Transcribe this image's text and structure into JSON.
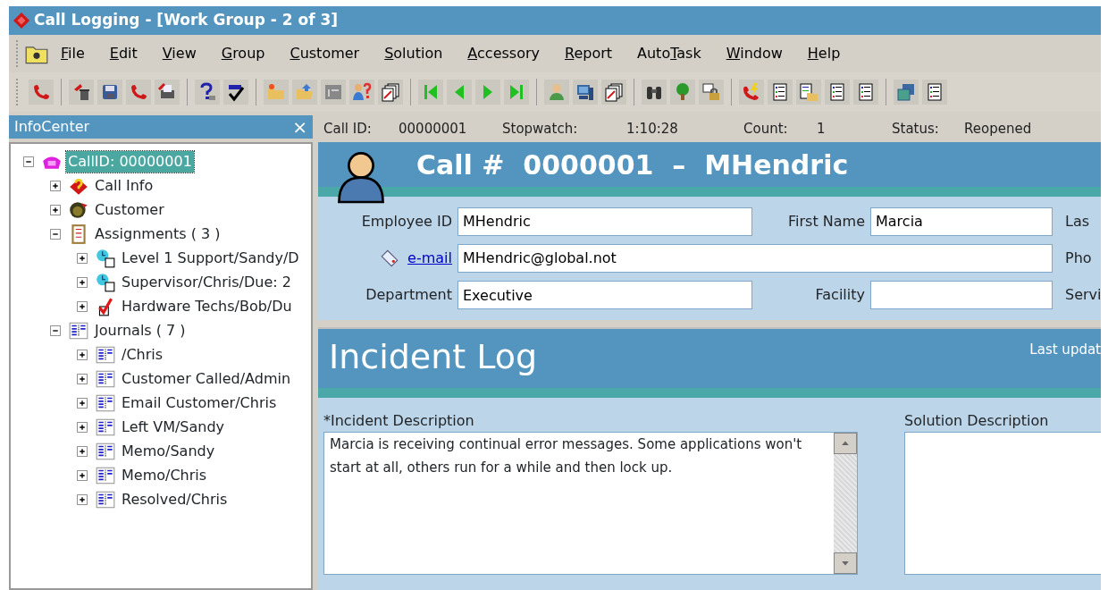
{
  "window": {
    "title": "Call Logging - [Work Group - 2 of 3]"
  },
  "menu": [
    {
      "key": "F",
      "post": "ile"
    },
    {
      "key": "E",
      "post": "dit"
    },
    {
      "key": "V",
      "post": "iew"
    },
    {
      "key": "G",
      "post": "roup"
    },
    {
      "key": "C",
      "post": "ustomer"
    },
    {
      "key": "S",
      "post": "olution"
    },
    {
      "key": "A",
      "post": "ccessory"
    },
    {
      "key": "R",
      "post": "eport"
    },
    {
      "pre": "Auto",
      "key": "T",
      "post": "ask"
    },
    {
      "key": "W",
      "post": "indow"
    },
    {
      "key": "H",
      "post": "elp"
    }
  ],
  "infocenter": {
    "title": "InfoCenter",
    "close": "×",
    "tree": [
      {
        "label": "CallID: 00000001",
        "kind": "root",
        "expanded": true,
        "selected": true,
        "children": [
          {
            "label": "Call Info",
            "kind": "info",
            "expanded": false,
            "selected": false
          },
          {
            "label": "Customer",
            "kind": "customer",
            "expanded": false,
            "selected": false
          },
          {
            "label": "Assignments ( 3 )",
            "kind": "assignments",
            "expanded": true,
            "selected": false,
            "children": [
              {
                "label": "Level 1 Support/Sandy/D",
                "kind": "pending",
                "expanded": false,
                "selected": false
              },
              {
                "label": "Supervisor/Chris/Due: 2",
                "kind": "pending",
                "expanded": false,
                "selected": false
              },
              {
                "label": "Hardware Techs/Bob/Du",
                "kind": "done",
                "expanded": false,
                "selected": false
              }
            ]
          },
          {
            "label": "Journals ( 7 )",
            "kind": "journal",
            "expanded": true,
            "selected": false,
            "children": [
              {
                "label": "/Chris",
                "kind": "journal",
                "expanded": false,
                "selected": false
              },
              {
                "label": "Customer Called/Admin",
                "kind": "journal",
                "expanded": false,
                "selected": false
              },
              {
                "label": "Email Customer/Chris",
                "kind": "journal",
                "expanded": false,
                "selected": false
              },
              {
                "label": "Left VM/Sandy",
                "kind": "journal",
                "expanded": false,
                "selected": false
              },
              {
                "label": "Memo/Sandy",
                "kind": "journal",
                "expanded": false,
                "selected": false
              },
              {
                "label": "Memo/Chris",
                "kind": "journal",
                "expanded": false,
                "selected": false
              },
              {
                "label": "Resolved/Chris",
                "kind": "journal",
                "expanded": false,
                "selected": false
              }
            ]
          }
        ]
      }
    ]
  },
  "status": [
    {
      "label": "Call ID:",
      "value": "00000001"
    },
    {
      "label": "Stopwatch:",
      "value": "1:10:28"
    },
    {
      "label": "Count:",
      "value": "1"
    },
    {
      "label": "Status:",
      "value": "Reopened"
    }
  ],
  "call_header": {
    "title": "Call #  0000001  –  MHendric"
  },
  "customer_form": {
    "rows": [
      [
        {
          "label": "Employee ID",
          "kind": "text",
          "value": "MHendric"
        },
        {
          "label": "First Name",
          "kind": "text",
          "value": "Marcia"
        },
        {
          "label": "Las",
          "kind": "cut"
        }
      ],
      [
        {
          "label": "e-mail",
          "kind": "link",
          "value": "MHendric@global.not"
        },
        "",
        {
          "label": "Pho",
          "kind": "cut"
        }
      ],
      [
        {
          "label": "Department",
          "kind": "text",
          "value": "Executive"
        },
        {
          "label": "Facility",
          "kind": "text"
        },
        {
          "label": "Servi",
          "kind": "cut"
        }
      ]
    ]
  },
  "incident_log": {
    "title": "Incident Log",
    "last_updated": "Last updat",
    "incident_label": "*Incident Description",
    "incident_text": "Marcia is receiving continual error messages. Some applications won't start at all, others run for a while and then lock up.",
    "solution_label": "Solution Description"
  }
}
